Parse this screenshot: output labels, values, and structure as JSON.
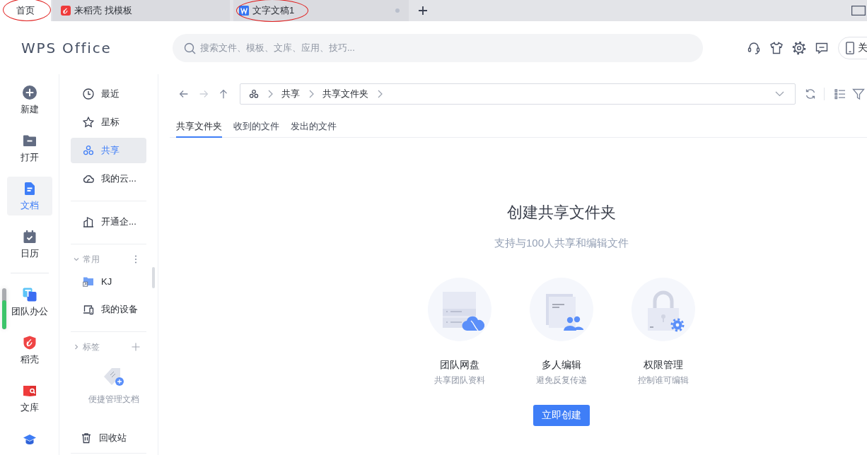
{
  "tabs": [
    {
      "kind": "home",
      "label": "首页",
      "selected": true,
      "annotated": true,
      "status_dot": false
    },
    {
      "kind": "docer",
      "label": "来稻壳 找模板",
      "selected": false,
      "annotated": false,
      "status_dot": false
    },
    {
      "kind": "writer",
      "label": "文字文稿1",
      "selected": false,
      "annotated": true,
      "status_dot": true
    }
  ],
  "header": {
    "logo": "WPS Office",
    "search": {
      "placeholder": "搜索文件、模板、文库、应用、技巧..."
    },
    "tools": [
      {
        "kind": "headset"
      },
      {
        "kind": "shirt"
      },
      {
        "kind": "settings"
      },
      {
        "kind": "message"
      }
    ],
    "device_button": {
      "label": "关"
    }
  },
  "nav_rail": {
    "groups": [
      [
        {
          "kind": "new",
          "label": "新建",
          "selected": false
        },
        {
          "kind": "open",
          "label": "打开",
          "selected": false
        },
        {
          "kind": "docs",
          "label": "文档",
          "selected": true
        },
        {
          "kind": "calendar",
          "label": "日历",
          "selected": false
        }
      ],
      [
        {
          "kind": "team",
          "label": "团队办公",
          "selected": false
        },
        {
          "kind": "docer",
          "label": "稻壳",
          "selected": false
        },
        {
          "kind": "library",
          "label": "文库",
          "selected": false
        },
        {
          "kind": "tool",
          "selected": false
        }
      ]
    ],
    "meter": {
      "level": 0.7
    }
  },
  "sidebar": {
    "sections": [
      {
        "items": [
          {
            "kind": "recent",
            "label": "最近",
            "selected": false
          },
          {
            "kind": "star",
            "label": "星标",
            "selected": false
          },
          {
            "kind": "share",
            "label": "共享",
            "selected": true
          },
          {
            "kind": "cloud",
            "label": "我的云...",
            "selected": false
          }
        ]
      },
      {
        "items": [
          {
            "kind": "enterprise",
            "label": "开通企...",
            "selected": false
          }
        ]
      },
      {
        "title": "常用",
        "expanded": true,
        "kind": "more",
        "items": [
          {
            "kind": "folder_link",
            "label": "KJ",
            "selected": false
          },
          {
            "kind": "device",
            "label": "我的设备",
            "selected": false
          }
        ]
      },
      {
        "title": "标签",
        "expanded": false,
        "kind": "add",
        "hint": "便捷管理文档"
      }
    ],
    "footer": {
      "kind": "trash",
      "label": "回收站"
    }
  },
  "toolbar": {
    "nav": [
      {
        "kind": "back",
        "disabled": false
      },
      {
        "kind": "forward",
        "disabled": true
      },
      {
        "kind": "up",
        "disabled": false
      }
    ],
    "path": [
      "共享",
      "共享文件夹"
    ],
    "tools": [
      {
        "kind": "refresh"
      },
      {
        "kind": "list"
      },
      {
        "kind": "filter"
      }
    ]
  },
  "content_tabs": [
    {
      "label": "共享文件夹",
      "selected": true
    },
    {
      "label": "收到的文件",
      "selected": false
    },
    {
      "label": "发出的文件",
      "selected": false
    }
  ],
  "empty_state": {
    "title": "创建共享文件夹",
    "subtitle": "支持与100人共享和编辑文件",
    "features": [
      {
        "kind": "drive",
        "title": "团队网盘",
        "caption": "共享团队资料"
      },
      {
        "kind": "coedit",
        "title": "多人编辑",
        "caption": "避免反复传递"
      },
      {
        "kind": "permission",
        "title": "权限管理",
        "caption": "控制谁可编辑"
      }
    ],
    "button": "立即创建"
  }
}
